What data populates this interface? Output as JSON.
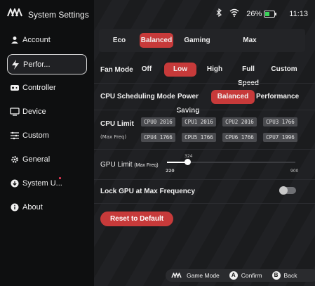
{
  "app": {
    "title": "System Settings"
  },
  "statusbar": {
    "battery_percent": "26%",
    "time": "11:13"
  },
  "sidebar": {
    "items": [
      {
        "label": "Account"
      },
      {
        "label": "Perfor..."
      },
      {
        "label": "Controller"
      },
      {
        "label": "Device"
      },
      {
        "label": "Custom"
      },
      {
        "label": "General"
      },
      {
        "label": "System U..."
      },
      {
        "label": "About"
      }
    ]
  },
  "performance": {
    "modes": [
      "Eco",
      "Balanced",
      "Gaming",
      "Max"
    ],
    "selected_mode": "Balanced",
    "fan_mode": {
      "label": "Fan Mode",
      "options": [
        "Off",
        "Low",
        "High",
        "Full Speed",
        "Custom"
      ],
      "selected": "Low"
    },
    "cpu_scheduling": {
      "label": "CPU Scheduling Mode",
      "options": [
        "Power Saving",
        "Balanced",
        "Performance"
      ],
      "selected": "Balanced"
    },
    "cpu_limit": {
      "label": "CPU Limit",
      "sub": "(Max Freq)",
      "cores": [
        "CPU0 2016",
        "CPU1 2016",
        "CPU2 2016",
        "CPU3 1766",
        "CPU4 1766",
        "CPU5 1766",
        "CPU6 1766",
        "CPU7 1996"
      ]
    },
    "gpu_limit": {
      "label": "GPU Limit",
      "sub": "(Max Freq)",
      "min": "220",
      "max": "900",
      "value": "324",
      "value_fraction": 0.15
    },
    "lock_gpu": {
      "label": "Lock GPU at Max Frequency",
      "enabled": false
    },
    "reset_label": "Reset to Default"
  },
  "hints": [
    {
      "icon": "game-mode-icon",
      "label": "Game Mode"
    },
    {
      "icon": "a-button-icon",
      "badge": "A",
      "label": "Confirm"
    },
    {
      "icon": "b-button-icon",
      "badge": "B",
      "label": "Back"
    }
  ],
  "colors": {
    "accent": "#c73a3a",
    "battery": "#3bd45a"
  }
}
